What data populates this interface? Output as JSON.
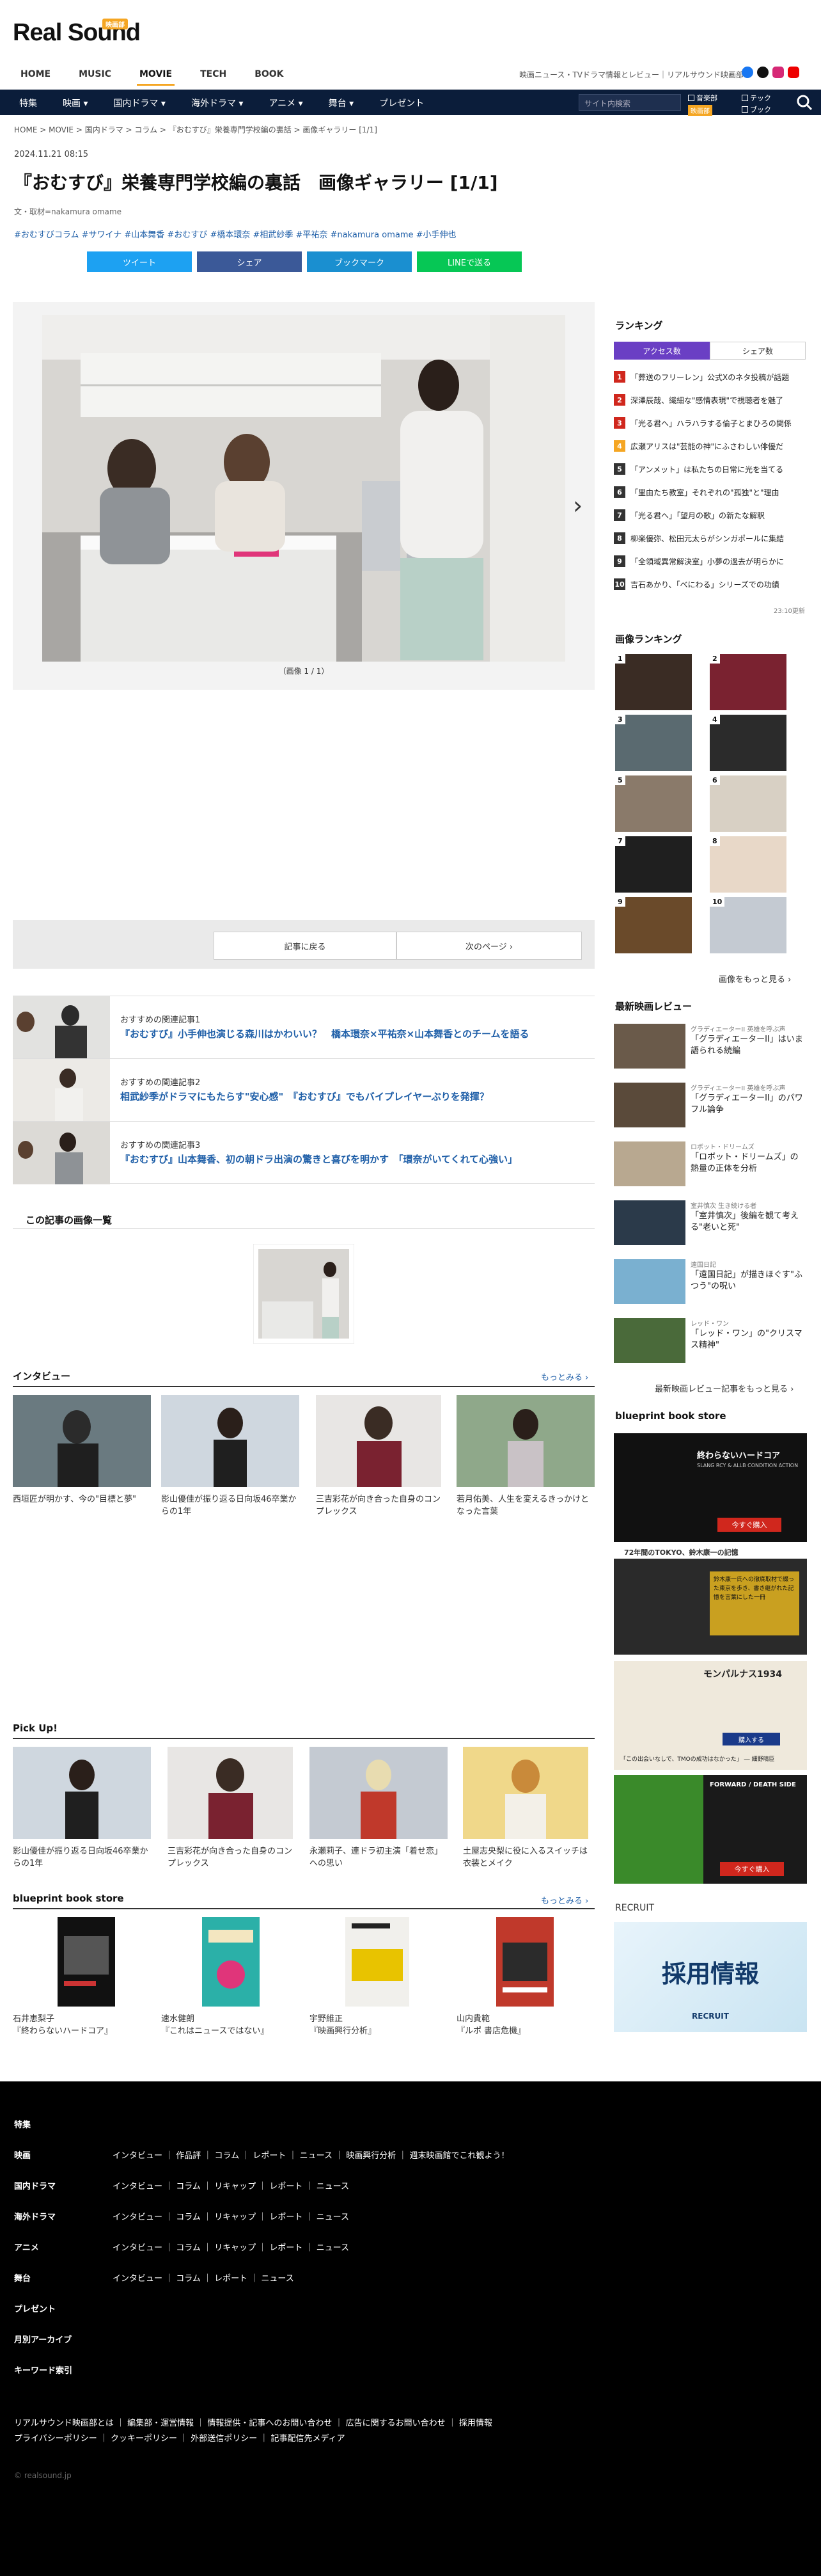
{
  "header": {
    "logo": "Real Sound",
    "logo_badge": "映画部",
    "nav": [
      "HOME",
      "MUSIC",
      "MOVIE",
      "TECH",
      "BOOK"
    ],
    "nav_active": "MOVIE",
    "tagline": "映画ニュース・TVドラマ情報とレビュー｜リアルサウンド映画部",
    "subnav": [
      "特集",
      "映画 ▾",
      "国内ドラマ ▾",
      "海外ドラマ ▾",
      "アニメ ▾",
      "舞台 ▾",
      "プレゼント"
    ],
    "search_placeholder": "サイト内検索",
    "checks": [
      "音楽部",
      "テック",
      "映画部",
      "ブック"
    ],
    "region_badge": "映画部"
  },
  "breadcrumb": "HOME  >  MOVIE  >  国内ドラマ  >  コラム  >  『おむすび』栄養専門学校編の裏話  >  画像ギャラリー [1/1]",
  "article": {
    "date": "2024.11.21 08:15",
    "title": "『おむすび』栄養専門学校編の裏話　画像ギャラリー [1/1]",
    "byline": "文・取材=nakamura omame",
    "tags": "#おむすびコラム  #サワイナ  #山本舞香  #おむすび  #橋本環奈  #相武紗季  #平祐奈  #nakamura omame  #小手伸也",
    "share": [
      "ツイート",
      "シェア",
      "ブックマーク",
      "LINEで送る"
    ],
    "caption": "（画像 1 / 1）",
    "pager_back": "記事に戻る",
    "pager_next": "次のページ ›"
  },
  "recommended": [
    {
      "label": "おすすめの関連記事1",
      "title": "『おむすび』小手伸也演じる森川はかわいい？　橋本環奈×平祐奈×山本舞香とのチームを語る"
    },
    {
      "label": "おすすめの関連記事2",
      "title": "相武紗季がドラマにもたらす\"安心感\"　『おむすび』でもバイプレイヤーぶりを発揮？"
    },
    {
      "label": "おすすめの関連記事3",
      "title": "『おむすび』山本舞香、初の朝ドラ出演の驚きと喜びを明かす　「環奈がいてくれて心強い」"
    }
  ],
  "gallery_list_title": "この記事の画像一覧",
  "interview": {
    "title": "インタビュー",
    "more": "もっとみる ›",
    "items": [
      "西垣匠が明かす、今の\"目標と夢\"",
      "影山優佳が振り返る日向坂46卒業からの1年",
      "三吉彩花が向き合った自身のコンプレックス",
      "若月佑美、人生を変えるきっかけとなった言葉"
    ]
  },
  "pickup": {
    "title": "Pick Up!",
    "items": [
      "影山優佳が振り返る日向坂46卒業からの1年",
      "三吉彩花が向き合った自身のコンプレックス",
      "永瀬莉子、連ドラ初主演「着せ恋」への思い",
      "土屋志央梨に役に入るスイッチは衣装とメイク"
    ]
  },
  "bookstore": {
    "title": "blueprint book store",
    "more": "もっとみる ›",
    "items": [
      {
        "author": "石井恵梨子",
        "book": "『終わらないハードコア』"
      },
      {
        "author": "速水健朗",
        "book": "『これはニュースではない』"
      },
      {
        "author": "宇野維正",
        "book": "『映画興行分析』"
      },
      {
        "author": "山内貴範",
        "book": "『ルポ 書店危機』"
      }
    ]
  },
  "sidebar": {
    "ranking_title": "ランキング",
    "tabs": [
      "アクセス数",
      "シェア数"
    ],
    "ranking": [
      "「葬送のフリーレン」公式Xのネタ投稿が話題",
      "深澤辰哉、繊細な\"感情表現\"で視聴者を魅了",
      "「光る君へ」ハラハラする倫子とまひろの関係",
      "広瀬アリスは\"芸能の神\"にふさわしい俳優だ",
      "「アンメット」は私たちの日常に光を当てる",
      "「里由たち教室」それぞれの\"孤独\"と\"理由",
      "「光る君へ」「望月の歌」の新たな解釈",
      "柳楽優弥、松田元太らがシンガポールに集結",
      "「全領域異常解決室」小夢の過去が明らかに",
      "吉石あかり、「べにわる」シリーズでの功績"
    ],
    "ranking_time": "23:10更新",
    "gallery_rank_title": "画像ランキング",
    "gallery_more": "画像をもっと見る ›",
    "reviews_title": "最新映画レビュー",
    "reviews": [
      {
        "sub": "グラディエーターII 英雄を呼ぶ声",
        "title": "「グラディエーターII」はいま語られる続編"
      },
      {
        "sub": "グラディエーターII 英雄を呼ぶ声",
        "title": "「グラディエーターII」のパワフル論争"
      },
      {
        "sub": "ロボット・ドリームズ",
        "title": "「ロボット・ドリームズ」の熱量の正体を分析"
      },
      {
        "sub": "室井慎次 生き続ける者",
        "title": "「室井慎次」後編を観て考える\"老いと死\""
      },
      {
        "sub": "遠国日記",
        "title": "「遠国日記」が描きほぐす\"ふつう\"の呪い"
      },
      {
        "sub": "レッド・ワン",
        "title": "「レッド・ワン」の\"クリスマス精神\""
      }
    ],
    "reviews_more": "最新映画レビュー記事をもっと見る ›",
    "bookstore_title": "blueprint book store",
    "book1_title": "終わらないハードコア",
    "book1_sub": "SLANG RCY & ALLB CONDITION ACTION",
    "book1_btn": "今すぐ購入",
    "book2_title": "72年間のTOKYO、鈴木康一の記憶",
    "book2_sub": "鈴木康一氏への徹底取材で綴った東京を歩き、書き継がれた記憶を言葉にした一冊",
    "book3_title": "モンパルナス1934",
    "book3_btn": "購入する",
    "book3_note": "「この出会いなしで、TMOの成功はなかった」 ― 細野晴臣",
    "book4_title": "FORWARD / DEATH SIDE",
    "book4_btn": "今すぐ購入",
    "recruit_title": "RECRUIT",
    "recruit_banner": "採用情報",
    "recruit_banner_sub": "RECRUIT"
  },
  "footer": {
    "groups": [
      {
        "head": "特集",
        "links": ""
      },
      {
        "head": "映画",
        "links": "インタビュー ｜ 作品評 ｜ コラム ｜ レポート ｜ ニュース ｜ 映画興行分析 ｜ 週末映画館でこれ観よう！"
      },
      {
        "head": "国内ドラマ",
        "links": "インタビュー ｜ コラム ｜ リキャップ ｜ レポート ｜ ニュース"
      },
      {
        "head": "海外ドラマ",
        "links": "インタビュー ｜ コラム ｜ リキャップ ｜ レポート ｜ ニュース"
      },
      {
        "head": "アニメ",
        "links": "インタビュー ｜ コラム ｜ リキャップ ｜ レポート ｜ ニュース"
      },
      {
        "head": "舞台",
        "links": "インタビュー ｜ コラム ｜ レポート ｜ ニュース"
      },
      {
        "head": "プレゼント",
        "links": ""
      },
      {
        "head": "月別アーカイブ",
        "links": ""
      },
      {
        "head": "キーワード索引",
        "links": ""
      }
    ],
    "bottom1": "リアルサウンド映画部とは ｜ 編集部・運営情報 ｜ 情報提供・記事へのお問い合わせ ｜ 広告に関するお問い合わせ ｜ 採用情報",
    "bottom2": "プライバシーポリシー ｜ クッキーポリシー ｜ 外部送信ポリシー ｜ 記事配信先メディア",
    "copyright": "© realsound.jp"
  },
  "colors": {
    "navy": "#0b1d3a",
    "accent": "#f5a623",
    "link": "#1f5fa8",
    "tab_active": "#6a3fc4",
    "rank_red": "#d0271d",
    "rank_orange": "#f5a623",
    "rank_dark": "#333333"
  }
}
